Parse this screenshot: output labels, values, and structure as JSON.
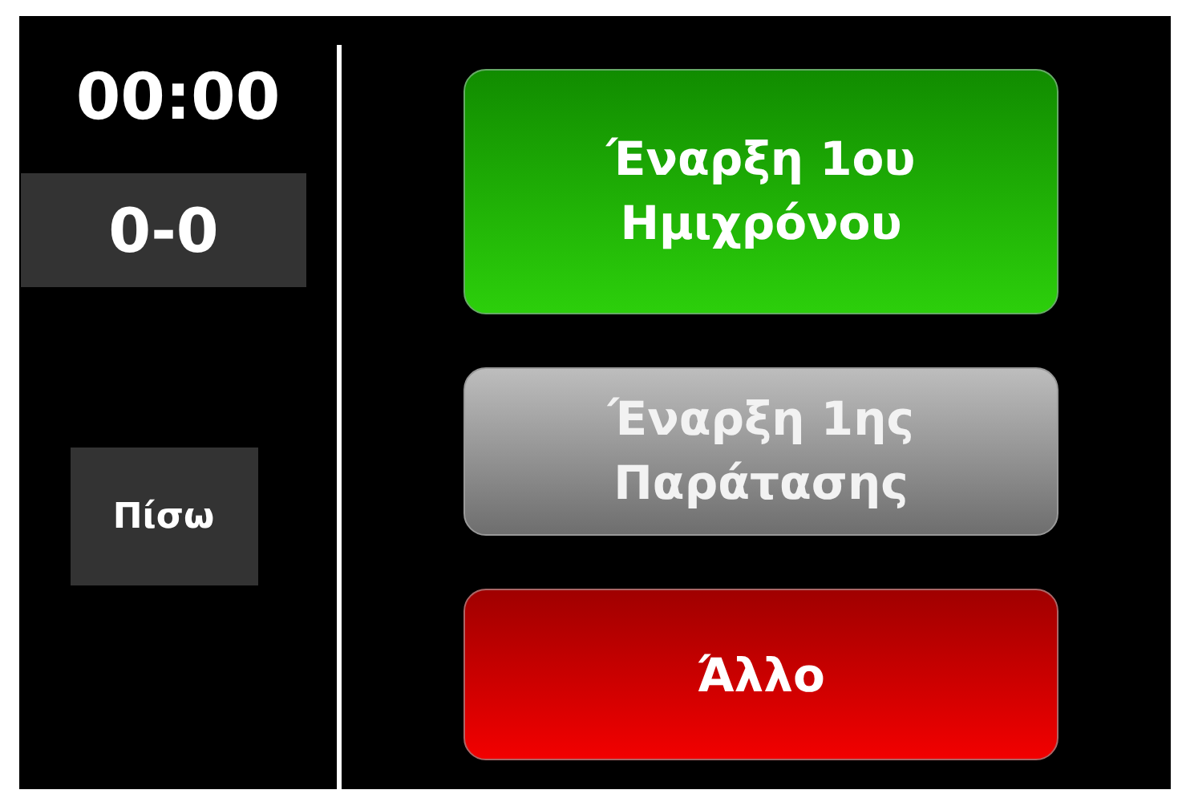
{
  "timer": "00:00",
  "score": "0-0",
  "back_button": {
    "label": "Πίσω"
  },
  "buttons": [
    {
      "label": "Έναρξη 1ου Ημιχρόνου",
      "kind": "success",
      "disabled": false
    },
    {
      "label": "Έναρξη 1ης Παράτασης",
      "kind": "default",
      "disabled": true
    },
    {
      "label": "Άλλο",
      "kind": "danger",
      "disabled": false
    }
  ]
}
